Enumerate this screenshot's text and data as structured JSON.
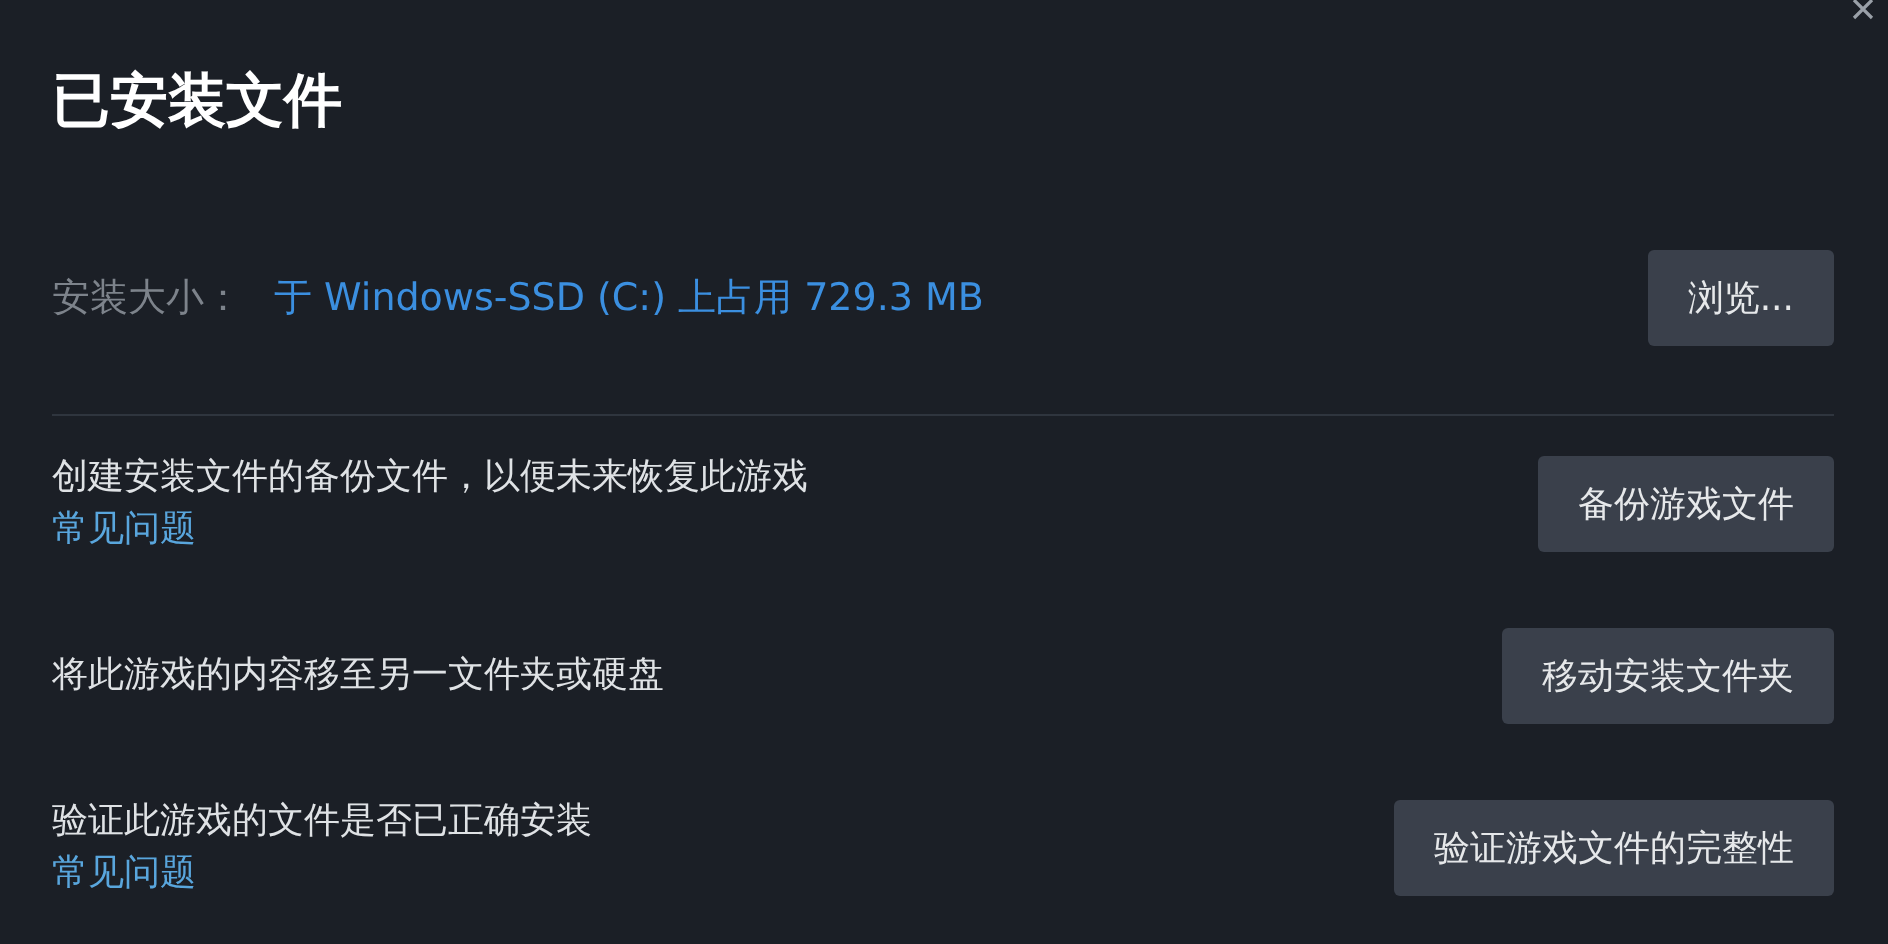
{
  "title": "已安装文件",
  "install_size": {
    "label": "安装大小：",
    "value": "于 Windows-SSD (C:) 上占用 729.3 MB",
    "button": "浏览..."
  },
  "rows": [
    {
      "text": "创建安装文件的备份文件，以便未来恢复此游戏",
      "link": "常见问题",
      "button": "备份游戏文件"
    },
    {
      "text": "将此游戏的内容移至另一文件夹或硬盘",
      "button": "移动安装文件夹"
    },
    {
      "text": "验证此游戏的文件是否已正确安装",
      "link": "常见问题",
      "button": "验证游戏文件的完整性"
    }
  ]
}
